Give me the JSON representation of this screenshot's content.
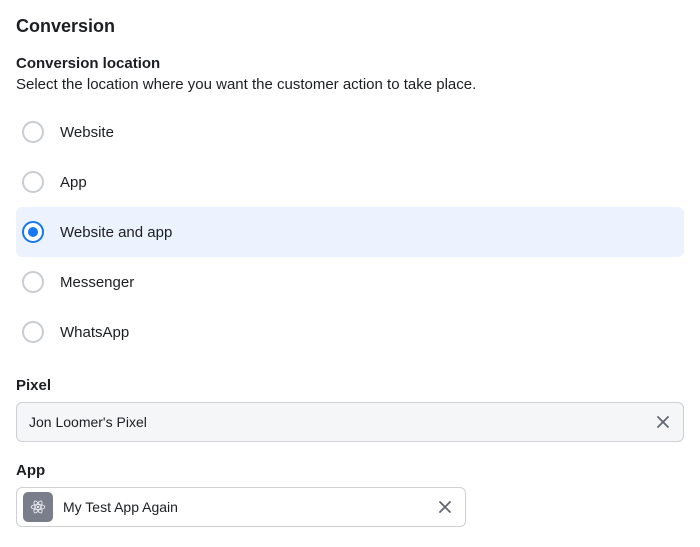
{
  "section": {
    "title": "Conversion"
  },
  "location": {
    "title": "Conversion location",
    "description": "Select the location where you want the customer action to take place.",
    "options": [
      {
        "label": "Website",
        "selected": false
      },
      {
        "label": "App",
        "selected": false
      },
      {
        "label": "Website and app",
        "selected": true
      },
      {
        "label": "Messenger",
        "selected": false
      },
      {
        "label": "WhatsApp",
        "selected": false
      }
    ]
  },
  "pixel": {
    "label": "Pixel",
    "value": "Jon Loomer's Pixel"
  },
  "app": {
    "label": "App",
    "value": "My Test App Again"
  }
}
